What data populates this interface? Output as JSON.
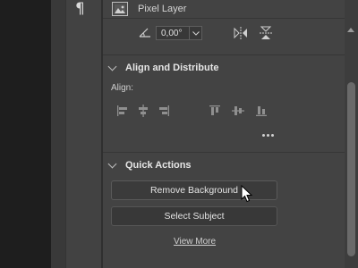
{
  "sidebar": {
    "paragraph_icon": "¶"
  },
  "properties": {
    "layer": {
      "label": "Pixel Layer",
      "icon": "image-icon"
    },
    "transform": {
      "angle_value": "0,00°"
    },
    "align_section": {
      "title": "Align and Distribute",
      "align_label": "Align:",
      "icons": [
        "align-left-edges-icon",
        "align-horizontal-centers-icon",
        "align-right-edges-icon",
        "align-top-edges-icon",
        "align-vertical-centers-icon",
        "align-bottom-edges-icon"
      ]
    },
    "quick_actions": {
      "title": "Quick Actions",
      "remove_bg_label": "Remove Background",
      "select_subject_label": "Select Subject",
      "view_more_label": "View More"
    }
  },
  "colors": {
    "panel": "#434343",
    "button": "#383838",
    "canvas": "#1e1e1e"
  }
}
